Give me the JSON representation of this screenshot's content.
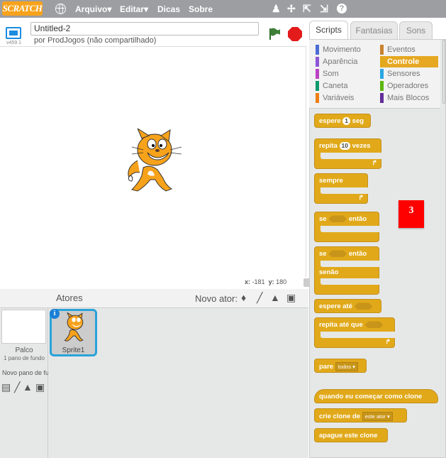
{
  "topbar": {
    "logo": "SCRATCH",
    "menus": [
      "Arquivo▾",
      "Editar▾",
      "Dicas",
      "Sobre"
    ],
    "tool_icons": [
      "duplicate-icon",
      "cut-icon",
      "grow-icon",
      "shrink-icon",
      "help-icon"
    ]
  },
  "stage_header": {
    "version": "v459.1",
    "project_title": "Untitled-2",
    "byline": "por ProdJogos (não compartilhado)"
  },
  "stage": {
    "coords_x_label": "x:",
    "coords_x": "-181",
    "coords_y_label": "y:",
    "coords_y": "180"
  },
  "sprites_pane": {
    "header": "Atores",
    "new_sprite_label": "Novo ator:",
    "stage_label": "Palco",
    "stage_sub": "1 pano de fundo",
    "new_backdrop_label": "Novo pano de fundo:",
    "sprites": [
      {
        "name": "Sprite1"
      }
    ],
    "info_glyph": "i"
  },
  "tabs": [
    {
      "label": "Scripts",
      "active": true
    },
    {
      "label": "Fantasias",
      "active": false
    },
    {
      "label": "Sons",
      "active": false
    }
  ],
  "categories": [
    {
      "label": "Movimento",
      "color": "#4a6cd4"
    },
    {
      "label": "Eventos",
      "color": "#c88330"
    },
    {
      "label": "Aparência",
      "color": "#8a55d7"
    },
    {
      "label": "Controle",
      "color": "#e1a91a",
      "active": true
    },
    {
      "label": "Som",
      "color": "#bb42c3"
    },
    {
      "label": "Sensores",
      "color": "#2ca5e2"
    },
    {
      "label": "Caneta",
      "color": "#0e9a6c"
    },
    {
      "label": "Operadores",
      "color": "#5cb712"
    },
    {
      "label": "Variáveis",
      "color": "#ee7d16"
    },
    {
      "label": "Mais Blocos",
      "color": "#632d99"
    }
  ],
  "blocks": {
    "wait": {
      "pre": "espere",
      "value": "1",
      "post": "seg"
    },
    "repeat": {
      "pre": "repita",
      "value": "10",
      "post": "vezes"
    },
    "forever": {
      "label": "sempre"
    },
    "if": {
      "pre": "se",
      "post": "então"
    },
    "ifelse": {
      "pre": "se",
      "post": "então",
      "else": "senão"
    },
    "wait_until": {
      "label": "espere até"
    },
    "repeat_until": {
      "label": "repita até que"
    },
    "stop": {
      "label": "pare",
      "option": "todos"
    },
    "clone_hat": {
      "label": "quando eu começar como clone"
    },
    "create_clone": {
      "label": "crie clone de",
      "option": "este ator"
    },
    "delete_clone": {
      "label": "apague este clone"
    }
  },
  "annotation_badge": "3",
  "colors": {
    "control": "#e1a91a",
    "topbar": "#9c9ea2",
    "selection": "#2ba2d9"
  }
}
